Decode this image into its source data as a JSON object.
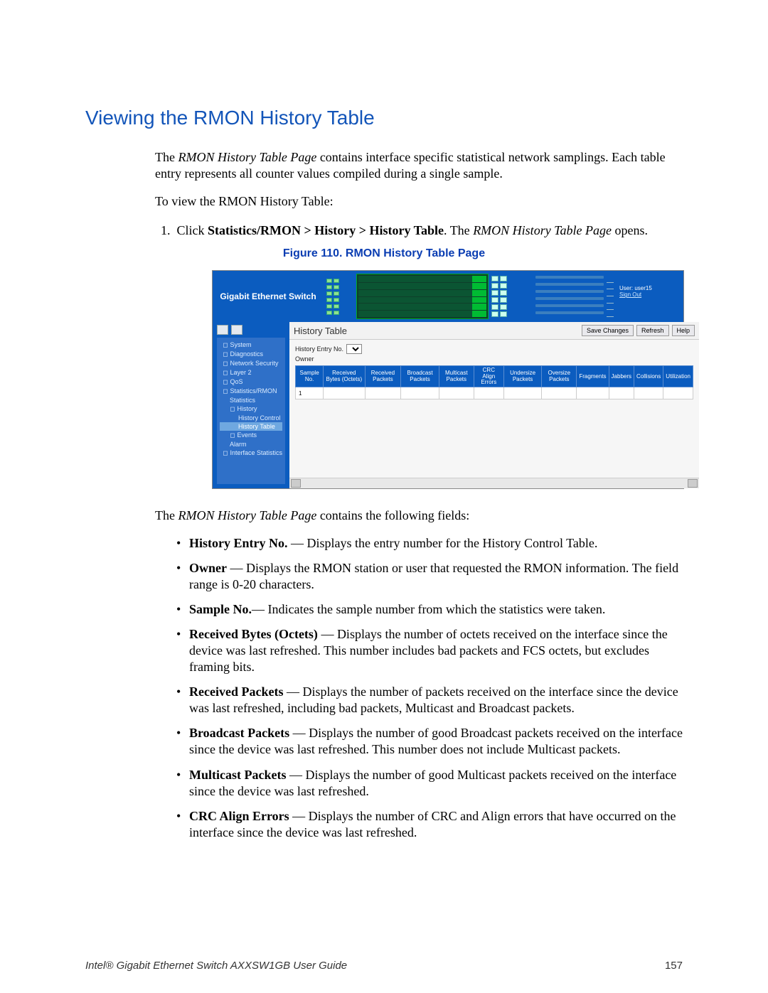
{
  "heading": "Viewing the RMON History Table",
  "intro": {
    "p1a": "The ",
    "p1_em": "RMON History Table Page",
    "p1b": " contains interface specific statistical network samplings. Each table entry represents all counter values compiled during a single sample.",
    "p2": "To view the RMON History Table:",
    "step_num": "1.",
    "step_a": "Click ",
    "step_bold": "Statistics/RMON > History > History Table",
    "step_b": ". The ",
    "step_em": "RMON History Table Page",
    "step_c": " opens."
  },
  "figure_caption": "Figure 110. RMON History Table Page",
  "screenshot": {
    "brand": "Gigabit Ethernet Switch",
    "user_label": "User: user15",
    "signout": "Sign Out",
    "panel_title": "History Table",
    "buttons": {
      "save": "Save Changes",
      "refresh": "Refresh",
      "help": "Help"
    },
    "params": {
      "entry_label": "History Entry No.",
      "owner_label": "Owner"
    },
    "nav": [
      {
        "label": "System",
        "lvl": 0,
        "mark": "◻"
      },
      {
        "label": "Diagnostics",
        "lvl": 0,
        "mark": "◻"
      },
      {
        "label": "Network Security",
        "lvl": 0,
        "mark": "◻"
      },
      {
        "label": "Layer 2",
        "lvl": 0,
        "mark": "◻"
      },
      {
        "label": "QoS",
        "lvl": 0,
        "mark": "◻"
      },
      {
        "label": "Statistics/RMON",
        "lvl": 0,
        "mark": "◻"
      },
      {
        "label": "Statistics",
        "lvl": 1,
        "mark": ""
      },
      {
        "label": "History",
        "lvl": 1,
        "mark": "◻"
      },
      {
        "label": "History Control",
        "lvl": 2,
        "mark": ""
      },
      {
        "label": "History Table",
        "lvl": 2,
        "mark": "",
        "active": true
      },
      {
        "label": "Events",
        "lvl": 1,
        "mark": "◻"
      },
      {
        "label": "Alarm",
        "lvl": 1,
        "mark": ""
      },
      {
        "label": "Interface Statistics",
        "lvl": 0,
        "mark": "◻"
      }
    ],
    "columns": [
      "Sample No.",
      "Received Bytes (Octets)",
      "Received Packets",
      "Broadcast Packets",
      "Multicast Packets",
      "CRC Align Errors",
      "Undersize Packets",
      "Oversize Packets",
      "Fragments",
      "Jabbers",
      "Collisions",
      "Utilization"
    ],
    "first_row_sample": "1"
  },
  "post_intro": {
    "a": "The ",
    "em": "RMON History Table Page",
    "b": " contains the following fields:"
  },
  "fields": [
    {
      "term": "History Entry No.",
      "sep": " — ",
      "desc": "Displays the entry number for the History Control Table."
    },
    {
      "term": "Owner",
      "sep": " — ",
      "desc": "Displays the RMON station or user that requested the RMON information. The field range is 0-20 characters."
    },
    {
      "term": "Sample No.",
      "sep": "— ",
      "desc": "Indicates the sample number from which the statistics were taken."
    },
    {
      "term": "Received Bytes (Octets)",
      "sep": " — ",
      "desc": "Displays the number of octets received on the interface since the device was last refreshed. This number includes bad packets and FCS octets, but excludes framing bits."
    },
    {
      "term": "Received Packets",
      "sep": " — ",
      "desc": "Displays the number of packets received on the interface since the device was last refreshed, including bad packets, Multicast and Broadcast packets."
    },
    {
      "term": "Broadcast Packets",
      "sep": " — ",
      "desc": "Displays the number of good Broadcast packets received on the interface since the device was last refreshed. This number does not include Multicast packets."
    },
    {
      "term": "Multicast Packets",
      "sep": " — ",
      "desc": "Displays the number of good Multicast packets received on the interface since the device was last refreshed."
    },
    {
      "term": "CRC Align Errors",
      "sep": " — ",
      "desc": "Displays the number of CRC and Align errors that have occurred on the interface since the device was last refreshed."
    }
  ],
  "footer": {
    "left": "Intel® Gigabit Ethernet Switch AXXSW1GB User Guide",
    "page": "157"
  }
}
